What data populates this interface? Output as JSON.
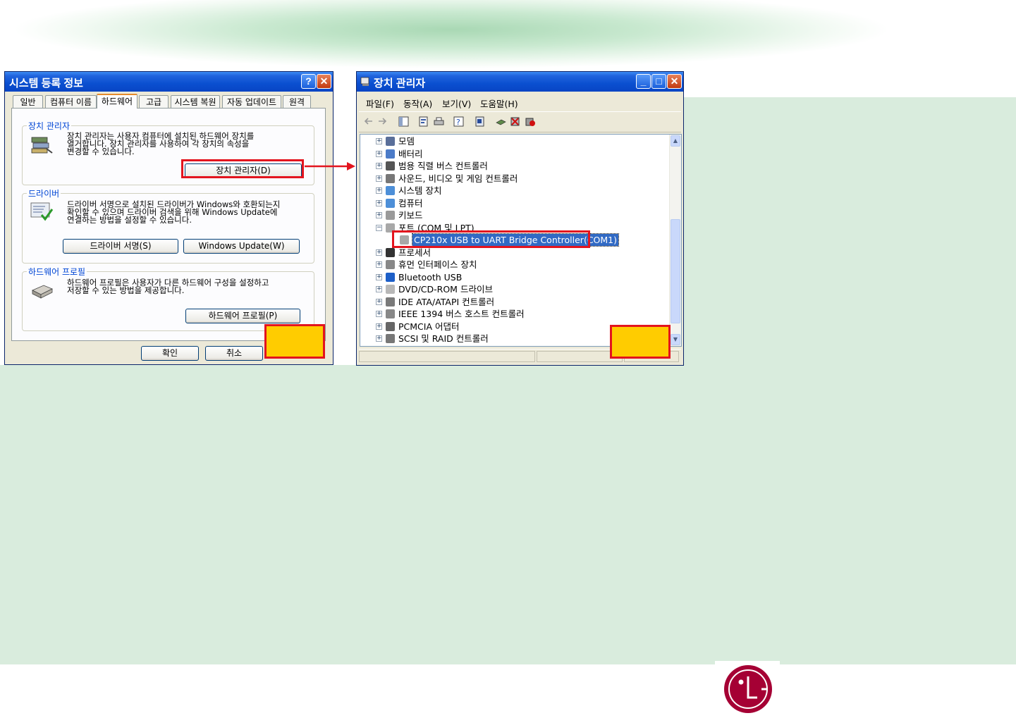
{
  "system_properties": {
    "title": "시스템 등록 정보",
    "tabs": [
      "일반",
      "컴퓨터 이름",
      "하드웨어",
      "고급",
      "시스템 복원",
      "자동 업데이트",
      "원격"
    ],
    "active_tab": "하드웨어",
    "device_manager_group": {
      "title": "장치 관리자",
      "line1": "장치 관리자는 사용자 컴퓨터에 설치된 하드웨어 장치를",
      "line2": "열거합니다. 장치 관리자를 사용하여 각 장치의 속성을",
      "line3": "변경할 수 있습니다.",
      "button": "장치 관리자(D)"
    },
    "driver_group": {
      "title": "드라이버",
      "line1": "드라이버 서명으로 설치된 드라이버가 Windows와 호환되는지",
      "line2": "확인할 수 있으며 드라이버 검색을 위해 Windows Update에",
      "line3": "연결하는 방법을 설정할 수 있습니다.",
      "button_signing": "드라이버 서명(S)",
      "button_update": "Windows Update(W)"
    },
    "profile_group": {
      "title": "하드웨어 프로필",
      "line1": "하드웨어 프로필은 사용자가 다른 하드웨어 구성을 설정하고",
      "line2": "저장할 수 있는 방법을 제공합니다.",
      "button": "하드웨어 프로필(P)"
    },
    "ok_button": "확인",
    "cancel_button": "취소"
  },
  "device_manager": {
    "title": "장치 관리자",
    "menu": [
      "파일(F)",
      "동작(A)",
      "보기(V)",
      "도움말(H)"
    ],
    "tree": [
      {
        "label": "모뎀",
        "icon": "modem-icon",
        "expanded": false
      },
      {
        "label": "배터리",
        "icon": "battery-icon",
        "expanded": false
      },
      {
        "label": "범용 직렬 버스 컨트롤러",
        "icon": "usb-icon",
        "expanded": false
      },
      {
        "label": "사운드, 비디오 및 게임 컨트롤러",
        "icon": "sound-icon",
        "expanded": false
      },
      {
        "label": "시스템 장치",
        "icon": "system-device-icon",
        "expanded": false
      },
      {
        "label": "컴퓨터",
        "icon": "computer-icon",
        "expanded": false
      },
      {
        "label": "키보드",
        "icon": "keyboard-icon",
        "expanded": false
      },
      {
        "label": "포트 (COM 및 LPT)",
        "icon": "port-icon",
        "expanded": true
      },
      {
        "label": "CP210x USB to UART Bridge Controller(COM1)",
        "icon": "port-icon",
        "child": true,
        "selected": true
      },
      {
        "label": "프로세서",
        "icon": "processor-icon",
        "expanded": false
      },
      {
        "label": "휴먼 인터페이스 장치",
        "icon": "hid-icon",
        "expanded": false
      },
      {
        "label": "Bluetooth USB",
        "icon": "bluetooth-icon",
        "expanded": false
      },
      {
        "label": "DVD/CD-ROM 드라이브",
        "icon": "dvd-icon",
        "expanded": false
      },
      {
        "label": "IDE ATA/ATAPI 컨트롤러",
        "icon": "ide-icon",
        "expanded": false
      },
      {
        "label": "IEEE 1394 버스 호스트 컨트롤러",
        "icon": "ieee1394-icon",
        "expanded": false
      },
      {
        "label": "PCMCIA 어댑터",
        "icon": "pcmcia-icon",
        "expanded": false
      },
      {
        "label": "SCSI 및 RAID 컨트롤러",
        "icon": "scsi-icon",
        "expanded": false
      }
    ]
  },
  "colors": {
    "highlight_red": "#e3141e",
    "marker_yellow": "#ffcc00",
    "background_green": "#d9ecdd",
    "xp_title_blue": "#0a4fd0",
    "selection_blue": "#316ac5",
    "lg_red": "#a50034"
  },
  "logo": {
    "text": "LG",
    "icon": "lg-logo-icon"
  }
}
